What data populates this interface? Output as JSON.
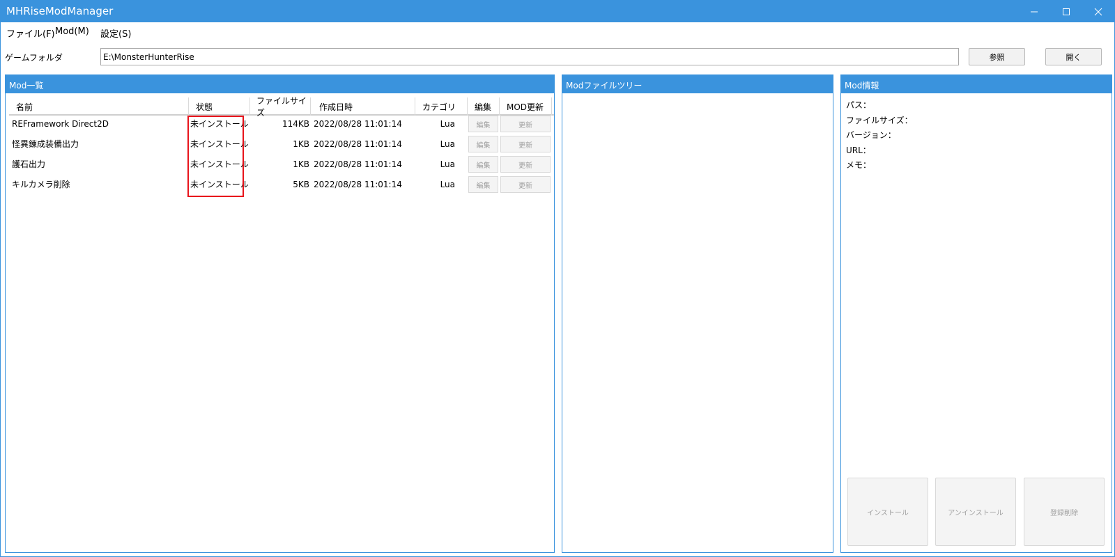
{
  "window": {
    "title": "MHRiseModManager"
  },
  "menu": {
    "file": "ファイル(F)",
    "mod": "Mod(M)",
    "settings": "設定(S)"
  },
  "folder": {
    "label": "ゲームフォルダ",
    "value": "E:\\MonsterHunterRise",
    "browse_label": "参照",
    "open_label": "開く"
  },
  "mod_list": {
    "title": "Mod一覧",
    "columns": {
      "name": "名前",
      "status": "状態",
      "size": "ファイルサイズ",
      "created": "作成日時",
      "category": "カテゴリ",
      "edit": "編集",
      "update": "MOD更新"
    },
    "edit_button": "編集",
    "update_button": "更新",
    "rows": [
      {
        "name": "REFramework Direct2D",
        "status": "未インストール",
        "size": "114KB",
        "created": "2022/08/28 11:01:14",
        "category": "Lua"
      },
      {
        "name": "怪異錬成装備出力",
        "status": "未インストール",
        "size": "1KB",
        "created": "2022/08/28 11:01:14",
        "category": "Lua"
      },
      {
        "name": "護石出力",
        "status": "未インストール",
        "size": "1KB",
        "created": "2022/08/28 11:01:14",
        "category": "Lua"
      },
      {
        "name": "キルカメラ削除",
        "status": "未インストール",
        "size": "5KB",
        "created": "2022/08/28 11:01:14",
        "category": "Lua"
      }
    ]
  },
  "file_tree": {
    "title": "Modファイルツリー"
  },
  "mod_info": {
    "title": "Mod情報",
    "path_label": "パス：",
    "size_label": "ファイルサイズ：",
    "version_label": "バージョン：",
    "url_label": "URL：",
    "memo_label": "メモ：",
    "install_button": "インストール",
    "uninstall_button": "アンインストール",
    "delete_button": "登録削除"
  },
  "colors": {
    "accent": "#3a93dd",
    "highlight": "#e8131b"
  }
}
